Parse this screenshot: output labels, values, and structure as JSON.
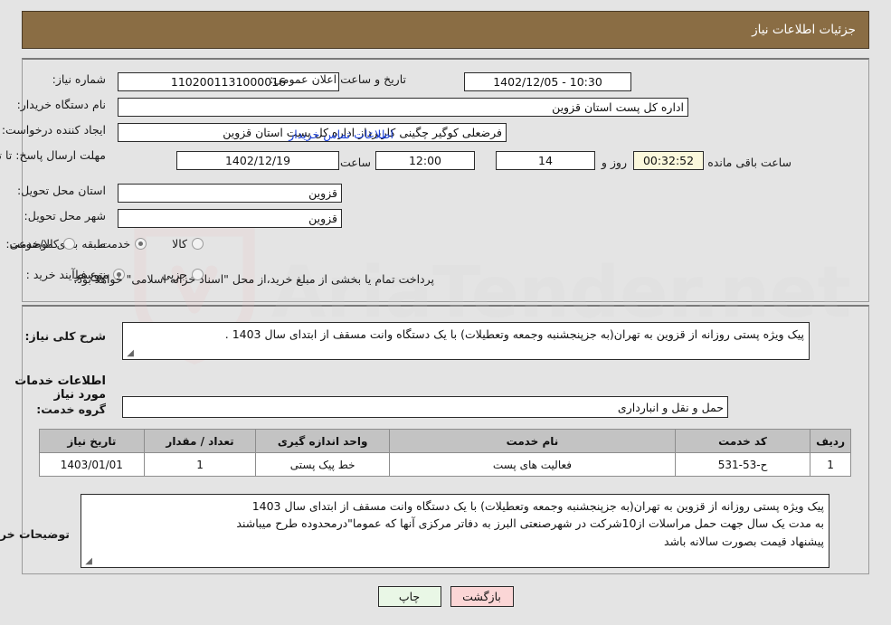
{
  "header": {
    "title": "جزئیات اطلاعات نیاز"
  },
  "form": {
    "need_number_label": "شماره نیاز:",
    "need_number_value": "1102001131000016",
    "public_announce_label": "تاریخ و ساعت اعلان عمومی:",
    "public_announce_value": "10:30 - 1402/12/05",
    "buyer_org_label": "نام دستگاه خریدار:",
    "buyer_org_value": "اداره کل پست استان قزوین",
    "creator_label": "ایجاد کننده درخواست:",
    "creator_value": "فرضعلی کوگیر چگینی کاربرداز اداره کل پست استان قزوین",
    "contact_link": "اطلاعات تماس خریدار",
    "deadline_label": "مهلت ارسال پاسخ: تا تاریخ:",
    "deadline_date": "1402/12/19",
    "deadline_hour_label": "ساعت",
    "deadline_hour_value": "12:00",
    "days_value": "14",
    "days_unit_label": "روز و",
    "timer_value": "00:32:52",
    "timer_suffix_label": "ساعت باقی مانده",
    "province_label": "استان محل تحویل:",
    "province_value": "قزوین",
    "city_label": "شهر محل تحویل:",
    "city_value": "قزوین",
    "category_label": "طبقه بندی موضوعی:",
    "category_options": [
      {
        "label": "کالا",
        "selected": false
      },
      {
        "label": "خدمت",
        "selected": true
      },
      {
        "label": "کالا/خدمت",
        "selected": false
      }
    ],
    "purchase_type_label": "نوع فرآیند خرید :",
    "purchase_type_options": [
      {
        "label": "جزیی",
        "selected": false
      },
      {
        "label": "متوسط",
        "selected": true
      }
    ],
    "payment_note": "پرداخت تمام یا بخشی از مبلغ خرید،از محل \"اسناد خزانه اسلامی\" خواهد بود."
  },
  "description": {
    "label": "شرح کلی نیاز:",
    "value": "پیک ویژه پستی روزانه از قزوین به تهران(به جزپنجشنبه وجمعه وتعطیلات) با یک دستگاه وانت مسقف از ابتدای سال 1403 ."
  },
  "services_section": {
    "heading": "اطلاعات خدمات مورد نیاز",
    "group_label": "گروه خدمت:",
    "group_value": "حمل و نقل و انبارداری"
  },
  "table": {
    "columns": [
      "ردیف",
      "کد خدمت",
      "نام خدمت",
      "واحد اندازه گیری",
      "تعداد / مقدار",
      "تاریخ نیاز"
    ],
    "rows": [
      [
        "1",
        "ح-53-531",
        "فعالیت های پست",
        "خط پیک پستی",
        "1",
        "1403/01/01"
      ]
    ]
  },
  "buyer_notes": {
    "label": "توضیحات خریدار:",
    "line1": "پیک ویژه پستی روزانه از قزوین به تهران(به جزپنجشنبه وجمعه وتعطیلات) با یک دستگاه وانت مسقف از ابتدای سال 1403",
    "line2": "به مدت یک سال جهت حمل مراسلات از10شرکت در شهرصنعتی البرز به دفاتر مرکزی آنها که عموما\"درمحدوده طرح میباشند",
    "line3": "پیشنهاد قیمت بصورت سالانه باشد"
  },
  "buttons": {
    "print": "چاپ",
    "back": "بازگشت"
  },
  "watermark": {
    "text": "AriaTender.net"
  },
  "colors": {
    "header_brown": "#8a6d44",
    "page_bg": "#e4e4e4",
    "link_blue": "#1a3fd8",
    "timer_bg": "#fbf8dc",
    "th_gray": "#c3c3c3",
    "print_btn": "#e9f7e6",
    "back_btn": "#fbd6d6"
  }
}
